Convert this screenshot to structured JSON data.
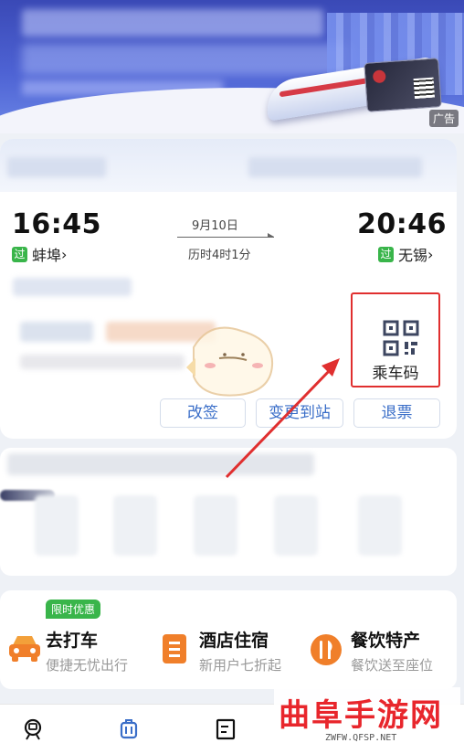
{
  "banner": {
    "ad_label": "广告"
  },
  "trip": {
    "depart_time": "16:45",
    "depart_station": "蚌埠",
    "arrive_time": "20:46",
    "arrive_station": "无锡",
    "pass_badge": "过",
    "chevron": "›",
    "date": "9月10日",
    "duration": "历时4时1分",
    "qr_label": "乘车码",
    "actions": [
      "改签",
      "变更到站",
      "退票"
    ]
  },
  "services": {
    "promo": "限时优惠",
    "items": [
      {
        "title": "去打车",
        "subtitle": "便捷无忧出行",
        "icon": "car-icon"
      },
      {
        "title": "酒店住宿",
        "subtitle": "新用户七折起",
        "icon": "hotel-icon"
      },
      {
        "title": "餐饮特产",
        "subtitle": "餐饮送至座位",
        "icon": "dining-icon"
      }
    ]
  },
  "tabbar": {
    "icons": [
      "train-home-icon",
      "luggage-icon",
      "list-icon"
    ]
  },
  "watermark": {
    "big": "曲阜手游网",
    "small": "ZWFW.QFSP.NET"
  },
  "colors": {
    "accent_blue": "#3a6ec8",
    "pass_green": "#39b54a",
    "highlight_red": "#e02f2f"
  }
}
